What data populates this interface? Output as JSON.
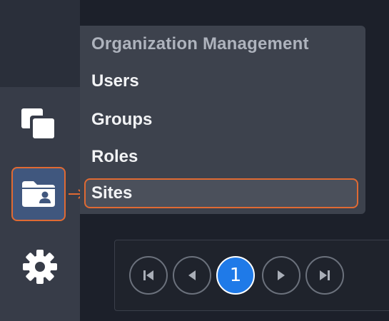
{
  "menu": {
    "header": "Organization Management",
    "items": [
      {
        "label": "Users"
      },
      {
        "label": "Groups"
      },
      {
        "label": "Roles"
      },
      {
        "label": "Sites",
        "highlighted": true
      }
    ]
  },
  "sidebar": {
    "icons": [
      "copy-icon",
      "org-folder-icon",
      "gear-icon"
    ],
    "active": "org-folder-icon"
  },
  "pagination": {
    "current_page": "1",
    "buttons": [
      "first-page-icon",
      "prev-page-icon",
      "next-page-icon",
      "last-page-icon"
    ]
  },
  "colors": {
    "highlight": "#e06a33",
    "active_page": "#1f7ae8",
    "active_sidebar": "#40577e"
  }
}
